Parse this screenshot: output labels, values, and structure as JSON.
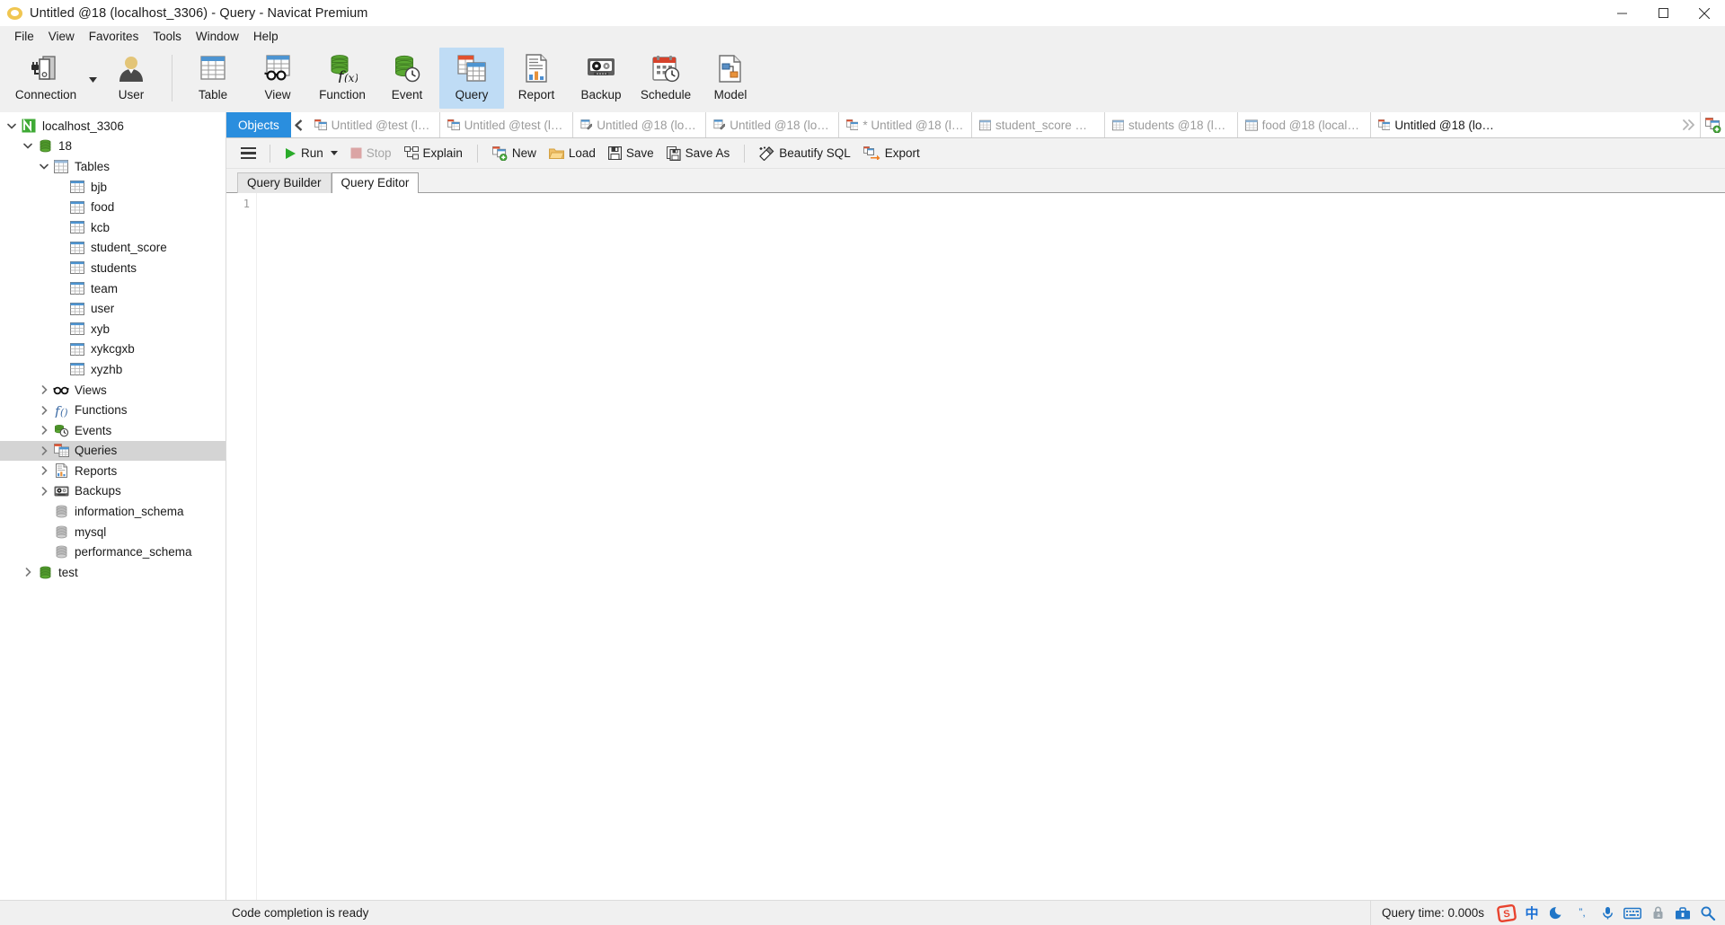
{
  "window": {
    "title": "Untitled @18 (localhost_3306) - Query - Navicat Premium",
    "app_icon": "navicat-logo-icon",
    "minimize_label": "Minimize",
    "maximize_label": "Maximize",
    "close_label": "Close"
  },
  "menubar": {
    "items": [
      {
        "label": "File"
      },
      {
        "label": "View"
      },
      {
        "label": "Favorites"
      },
      {
        "label": "Tools"
      },
      {
        "label": "Window"
      },
      {
        "label": "Help"
      }
    ]
  },
  "toolbar": {
    "buttons": [
      {
        "label": "Connection",
        "icon": "connection-icon",
        "selected": false,
        "has_caret": true
      },
      {
        "label": "User",
        "icon": "user-icon",
        "selected": false,
        "has_caret": false
      },
      {
        "label": "Table",
        "icon": "table-icon",
        "selected": false,
        "has_caret": false
      },
      {
        "label": "View",
        "icon": "view-icon",
        "selected": false,
        "has_caret": false
      },
      {
        "label": "Function",
        "icon": "function-icon",
        "selected": false,
        "has_caret": false
      },
      {
        "label": "Event",
        "icon": "event-icon",
        "selected": false,
        "has_caret": false
      },
      {
        "label": "Query",
        "icon": "query-icon",
        "selected": true,
        "has_caret": false
      },
      {
        "label": "Report",
        "icon": "report-icon",
        "selected": false,
        "has_caret": false
      },
      {
        "label": "Backup",
        "icon": "backup-icon",
        "selected": false,
        "has_caret": false
      },
      {
        "label": "Schedule",
        "icon": "schedule-icon",
        "selected": false,
        "has_caret": false
      },
      {
        "label": "Model",
        "icon": "model-icon",
        "selected": false,
        "has_caret": false
      }
    ]
  },
  "sidebar": {
    "items": [
      {
        "label": "localhost_3306",
        "icon": "connection-host-icon",
        "indent": 0,
        "twisty": "down",
        "selected": false
      },
      {
        "label": "18",
        "icon": "database-active-icon",
        "indent": 1,
        "twisty": "down",
        "selected": false
      },
      {
        "label": "Tables",
        "icon": "tables-folder-icon",
        "indent": 2,
        "twisty": "down",
        "selected": false
      },
      {
        "label": "bjb",
        "icon": "table-icon",
        "indent": 3,
        "twisty": "none",
        "selected": false
      },
      {
        "label": "food",
        "icon": "table-icon",
        "indent": 3,
        "twisty": "none",
        "selected": false
      },
      {
        "label": "kcb",
        "icon": "table-icon",
        "indent": 3,
        "twisty": "none",
        "selected": false
      },
      {
        "label": "student_score",
        "icon": "table-icon",
        "indent": 3,
        "twisty": "none",
        "selected": false
      },
      {
        "label": "students",
        "icon": "table-icon",
        "indent": 3,
        "twisty": "none",
        "selected": false
      },
      {
        "label": "team",
        "icon": "table-icon",
        "indent": 3,
        "twisty": "none",
        "selected": false
      },
      {
        "label": "user",
        "icon": "table-icon",
        "indent": 3,
        "twisty": "none",
        "selected": false
      },
      {
        "label": "xyb",
        "icon": "table-icon",
        "indent": 3,
        "twisty": "none",
        "selected": false
      },
      {
        "label": "xykcgxb",
        "icon": "table-icon",
        "indent": 3,
        "twisty": "none",
        "selected": false
      },
      {
        "label": "xyzhb",
        "icon": "table-icon",
        "indent": 3,
        "twisty": "none",
        "selected": false
      },
      {
        "label": "Views",
        "icon": "views-icon",
        "indent": 2,
        "twisty": "right",
        "selected": false
      },
      {
        "label": "Functions",
        "icon": "functions-icon",
        "indent": 2,
        "twisty": "right",
        "selected": false
      },
      {
        "label": "Events",
        "icon": "events-icon",
        "indent": 2,
        "twisty": "right",
        "selected": false
      },
      {
        "label": "Queries",
        "icon": "queries-icon",
        "indent": 2,
        "twisty": "right",
        "selected": true
      },
      {
        "label": "Reports",
        "icon": "reports-icon",
        "indent": 2,
        "twisty": "right",
        "selected": false
      },
      {
        "label": "Backups",
        "icon": "backups-icon",
        "indent": 2,
        "twisty": "right",
        "selected": false
      },
      {
        "label": "information_schema",
        "icon": "database-inactive-icon",
        "indent": 1,
        "twisty": "none",
        "selected": false
      },
      {
        "label": "mysql",
        "icon": "database-inactive-icon",
        "indent": 1,
        "twisty": "none",
        "selected": false
      },
      {
        "label": "performance_schema",
        "icon": "database-inactive-icon",
        "indent": 1,
        "twisty": "none",
        "selected": false
      },
      {
        "label": "test",
        "icon": "database-active-icon",
        "indent": 1,
        "twisty": "right",
        "selected": false
      }
    ]
  },
  "tabstrip": {
    "objects_label": "Objects",
    "scroll_left_icon": "chevron-left-icon",
    "more_icon": "chevron-double-right-icon",
    "new_tab_icon": "new-query-tab-icon",
    "tabs": [
      {
        "label": "Untitled @test (loc...",
        "icon": "query-tab-icon",
        "active": false
      },
      {
        "label": "Untitled @test (loc...",
        "icon": "query-builder-tab-icon",
        "active": false
      },
      {
        "label": "Untitled @18 (local...",
        "icon": "edit-tab-icon",
        "active": false
      },
      {
        "label": "Untitled @18 (local...",
        "icon": "edit-tab-icon",
        "active": false
      },
      {
        "label": "* Untitled @18 (loc...",
        "icon": "query-builder-tab-icon",
        "active": false
      },
      {
        "label": "student_score @18...",
        "icon": "table-tab-icon",
        "active": false
      },
      {
        "label": "students @18 (loca...",
        "icon": "table-tab-icon",
        "active": false
      },
      {
        "label": "food @18 (localho...",
        "icon": "table-tab-icon",
        "active": false
      },
      {
        "label": "Untitled @18 (local...",
        "icon": "query-builder-tab-icon",
        "active": true
      }
    ]
  },
  "query_toolbar": {
    "menu_icon": "hamburger-menu-icon",
    "buttons": [
      {
        "label": "Run",
        "icon": "run-icon",
        "disabled": false,
        "has_caret": true
      },
      {
        "label": "Stop",
        "icon": "stop-icon",
        "disabled": true,
        "has_caret": false
      },
      {
        "label": "Explain",
        "icon": "explain-icon",
        "disabled": false,
        "has_caret": false
      },
      {
        "label": "New",
        "icon": "new-icon",
        "disabled": false,
        "has_caret": false
      },
      {
        "label": "Load",
        "icon": "load-icon",
        "disabled": false,
        "has_caret": false
      },
      {
        "label": "Save",
        "icon": "save-icon",
        "disabled": false,
        "has_caret": false
      },
      {
        "label": "Save As",
        "icon": "save-as-icon",
        "disabled": false,
        "has_caret": false
      },
      {
        "label": "Beautify SQL",
        "icon": "beautify-icon",
        "disabled": false,
        "has_caret": false
      },
      {
        "label": "Export",
        "icon": "export-icon",
        "disabled": false,
        "has_caret": false
      }
    ]
  },
  "subtabs": [
    {
      "label": "Query Builder",
      "active": false
    },
    {
      "label": "Query Editor",
      "active": true
    }
  ],
  "editor": {
    "line_numbers": [
      "1"
    ],
    "content": "",
    "placeholder": ""
  },
  "statusbar": {
    "message": "Code completion is ready",
    "query_time": "Query time: 0.000s",
    "tray": [
      {
        "icon": "sogou-logo-icon",
        "label": "S"
      },
      {
        "icon": "chinese-input-icon",
        "label": "中"
      },
      {
        "icon": "moon-icon",
        "label": ""
      },
      {
        "icon": "punctuation-icon",
        "label": "”,"
      },
      {
        "icon": "microphone-icon",
        "label": ""
      },
      {
        "icon": "keyboard-icon",
        "label": ""
      },
      {
        "icon": "lock-icon",
        "label": ""
      },
      {
        "icon": "toolbox-icon",
        "label": ""
      },
      {
        "icon": "settings-icon",
        "label": ""
      }
    ]
  },
  "colors": {
    "accent": "#2a8ede",
    "toolbar_bg": "#f0f0f0",
    "selected_tool_bg": "#bfdcf5",
    "tree_selected_bg": "#d4d4d4",
    "green": "#5aa832",
    "orange": "#e8792c"
  }
}
